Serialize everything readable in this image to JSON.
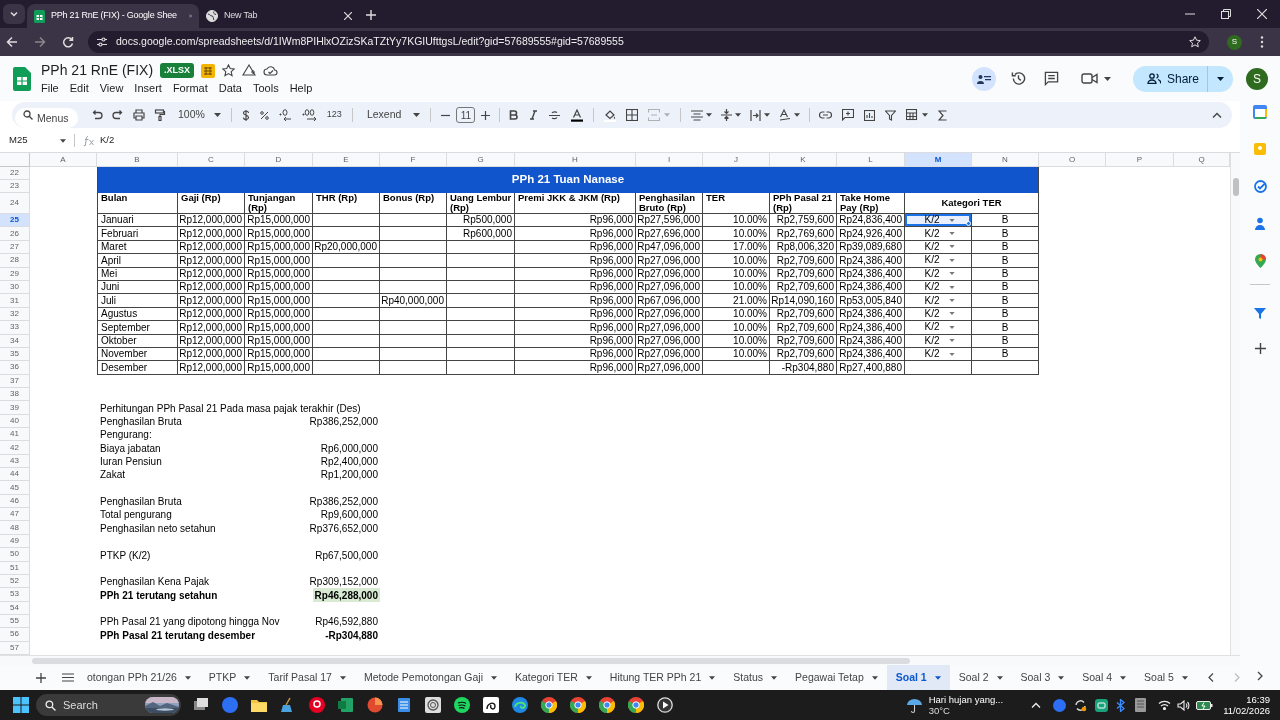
{
  "browser": {
    "tabs": [
      {
        "kind": "sheets",
        "title": "PPh 21 RnE (FIX) - Google Shee",
        "selected": true
      },
      {
        "kind": "web",
        "title": "New Tab",
        "selected": false
      }
    ],
    "url": "docs.google.com/spreadsheets/d/1IWm8PIHlxOZizSKaTZtYy7KGIUfttgsL/edit?gid=57689555#gid=57689555",
    "profile": "S"
  },
  "header": {
    "title": "PPh 21 RnE (FIX)",
    "badge": ".XLSX",
    "menu": [
      "File",
      "Edit",
      "View",
      "Insert",
      "Format",
      "Data",
      "Tools",
      "Help"
    ],
    "share": "Share",
    "avatar": "S"
  },
  "toolbar": {
    "search": {
      "placeholder": "Menus"
    },
    "zoom": "100%",
    "number_format": "123",
    "font": "Lexend",
    "font_size": "11"
  },
  "formula_bar": {
    "cell": "M25",
    "formula": "K/2"
  },
  "sheet": {
    "columns": [
      {
        "label": "A",
        "selected": false
      },
      {
        "label": "B",
        "selected": false
      },
      {
        "label": "C",
        "selected": false
      },
      {
        "label": "D",
        "selected": false
      },
      {
        "label": "E",
        "selected": false
      },
      {
        "label": "F",
        "selected": false
      },
      {
        "label": "G",
        "selected": false
      },
      {
        "label": "H",
        "selected": false
      },
      {
        "label": "I",
        "selected": false
      },
      {
        "label": "J",
        "selected": false
      },
      {
        "label": "K",
        "selected": false
      },
      {
        "label": "L",
        "selected": false
      },
      {
        "label": "M",
        "selected": true
      },
      {
        "label": "N",
        "selected": false
      },
      {
        "label": "O",
        "selected": false
      },
      {
        "label": "P",
        "selected": false
      },
      {
        "label": "Q",
        "selected": false
      }
    ],
    "row_numbers": [
      {
        "label": "22",
        "selected": false
      },
      {
        "label": "23",
        "selected": false
      },
      {
        "label": "24",
        "selected": false
      },
      {
        "label": "25",
        "selected": true
      },
      {
        "label": "26",
        "selected": false
      },
      {
        "label": "27",
        "selected": false
      },
      {
        "label": "28",
        "selected": false
      },
      {
        "label": "29",
        "selected": false
      },
      {
        "label": "30",
        "selected": false
      },
      {
        "label": "31",
        "selected": false
      },
      {
        "label": "32",
        "selected": false
      },
      {
        "label": "33",
        "selected": false
      },
      {
        "label": "34",
        "selected": false
      },
      {
        "label": "35",
        "selected": false
      },
      {
        "label": "36",
        "selected": false
      },
      {
        "label": "37",
        "selected": false
      },
      {
        "label": "38",
        "selected": false
      },
      {
        "label": "39",
        "selected": false
      },
      {
        "label": "40",
        "selected": false
      },
      {
        "label": "41",
        "selected": false
      },
      {
        "label": "42",
        "selected": false
      },
      {
        "label": "43",
        "selected": false
      },
      {
        "label": "44",
        "selected": false
      },
      {
        "label": "45",
        "selected": false
      },
      {
        "label": "46",
        "selected": false
      },
      {
        "label": "47",
        "selected": false
      },
      {
        "label": "48",
        "selected": false
      },
      {
        "label": "49",
        "selected": false
      },
      {
        "label": "50",
        "selected": false
      },
      {
        "label": "51",
        "selected": false
      },
      {
        "label": "52",
        "selected": false
      },
      {
        "label": "53",
        "selected": false
      },
      {
        "label": "54",
        "selected": false
      },
      {
        "label": "55",
        "selected": false
      },
      {
        "label": "56",
        "selected": false
      },
      {
        "label": "57",
        "selected": false
      }
    ],
    "table": {
      "title": "PPh 21 Tuan Nanase",
      "columns": [
        "Bulan",
        "Gaji (Rp)",
        "Tunjangan (Rp)",
        "THR (Rp)",
        "Bonus (Rp)",
        "Uang Lembur (Rp)",
        "Premi JKK & JKM (Rp)",
        "Penghasilan Bruto (Rp)",
        "TER",
        "PPh Pasal 21 (Rp)",
        "Take Home Pay (Rp)",
        "Kategori TER"
      ],
      "rows": [
        {
          "bulan": "Januari",
          "gaji": "Rp12,000,000",
          "tunjangan": "Rp15,000,000",
          "lembur": "Rp500,000",
          "premi": "Rp96,000",
          "bruto": "Rp27,596,000",
          "ter": "10.00%",
          "pph": "Rp2,759,600",
          "thp": "Rp24,836,400",
          "kategori": "K/2",
          "golongan": "B",
          "selected": true
        },
        {
          "bulan": "Februari",
          "gaji": "Rp12,000,000",
          "tunjangan": "Rp15,000,000",
          "lembur": "Rp600,000",
          "premi": "Rp96,000",
          "bruto": "Rp27,696,000",
          "ter": "10.00%",
          "pph": "Rp2,769,600",
          "thp": "Rp24,926,400",
          "kategori": "K/2",
          "golongan": "B",
          "selected": false
        },
        {
          "bulan": "Maret",
          "gaji": "Rp12,000,000",
          "tunjangan": "Rp15,000,000",
          "thr": "Rp20,000,000",
          "premi": "Rp96,000",
          "bruto": "Rp47,096,000",
          "ter": "17.00%",
          "pph": "Rp8,006,320",
          "thp": "Rp39,089,680",
          "kategori": "K/2",
          "golongan": "B",
          "selected": false
        },
        {
          "bulan": "April",
          "gaji": "Rp12,000,000",
          "tunjangan": "Rp15,000,000",
          "premi": "Rp96,000",
          "bruto": "Rp27,096,000",
          "ter": "10.00%",
          "pph": "Rp2,709,600",
          "thp": "Rp24,386,400",
          "kategori": "K/2",
          "golongan": "B",
          "selected": false
        },
        {
          "bulan": "Mei",
          "gaji": "Rp12,000,000",
          "tunjangan": "Rp15,000,000",
          "premi": "Rp96,000",
          "bruto": "Rp27,096,000",
          "ter": "10.00%",
          "pph": "Rp2,709,600",
          "thp": "Rp24,386,400",
          "kategori": "K/2",
          "golongan": "B",
          "selected": false
        },
        {
          "bulan": "Juni",
          "gaji": "Rp12,000,000",
          "tunjangan": "Rp15,000,000",
          "premi": "Rp96,000",
          "bruto": "Rp27,096,000",
          "ter": "10.00%",
          "pph": "Rp2,709,600",
          "thp": "Rp24,386,400",
          "kategori": "K/2",
          "golongan": "B",
          "selected": false
        },
        {
          "bulan": "Juli",
          "gaji": "Rp12,000,000",
          "tunjangan": "Rp15,000,000",
          "bonus": "Rp40,000,000",
          "premi": "Rp96,000",
          "bruto": "Rp67,096,000",
          "ter": "21.00%",
          "pph": "Rp14,090,160",
          "thp": "Rp53,005,840",
          "kategori": "K/2",
          "golongan": "B",
          "selected": false
        },
        {
          "bulan": "Agustus",
          "gaji": "Rp12,000,000",
          "tunjangan": "Rp15,000,000",
          "premi": "Rp96,000",
          "bruto": "Rp27,096,000",
          "ter": "10.00%",
          "pph": "Rp2,709,600",
          "thp": "Rp24,386,400",
          "kategori": "K/2",
          "golongan": "B",
          "selected": false
        },
        {
          "bulan": "September",
          "gaji": "Rp12,000,000",
          "tunjangan": "Rp15,000,000",
          "premi": "Rp96,000",
          "bruto": "Rp27,096,000",
          "ter": "10.00%",
          "pph": "Rp2,709,600",
          "thp": "Rp24,386,400",
          "kategori": "K/2",
          "golongan": "B",
          "selected": false
        },
        {
          "bulan": "Oktober",
          "gaji": "Rp12,000,000",
          "tunjangan": "Rp15,000,000",
          "premi": "Rp96,000",
          "bruto": "Rp27,096,000",
          "ter": "10.00%",
          "pph": "Rp2,709,600",
          "thp": "Rp24,386,400",
          "kategori": "K/2",
          "golongan": "B",
          "selected": false
        },
        {
          "bulan": "November",
          "gaji": "Rp12,000,000",
          "tunjangan": "Rp15,000,000",
          "premi": "Rp96,000",
          "bruto": "Rp27,096,000",
          "ter": "10.00%",
          "pph": "Rp2,709,600",
          "thp": "Rp24,386,400",
          "kategori": "K/2",
          "golongan": "B",
          "selected": false
        },
        {
          "bulan": "Desember",
          "gaji": "Rp12,000,000",
          "tunjangan": "Rp15,000,000",
          "premi": "Rp96,000",
          "bruto": "Rp27,096,000",
          "pph": "-Rp304,880",
          "thp": "Rp27,400,880",
          "selected": false
        }
      ]
    },
    "summary": [
      [
        {
          "label": "Perhitungan PPh Pasal 21 Pada masa pajak terakhir (Des)",
          "bold": false,
          "highlighted": false
        },
        {
          "label": "Penghasilan Bruta",
          "value": "Rp386,252,000",
          "bold": false,
          "highlighted": false
        },
        {
          "label": "Pengurang:",
          "bold": false,
          "highlighted": false
        },
        {
          "label": "Biaya jabatan",
          "value": "Rp6,000,000",
          "bold": false,
          "highlighted": false
        },
        {
          "label": "Iuran Pensiun",
          "value": "Rp2,400,000",
          "bold": false,
          "highlighted": false
        },
        {
          "label": "Zakat",
          "value": "Rp1,200,000",
          "bold": false,
          "highlighted": false
        }
      ],
      [
        {
          "label": "Penghasilan Bruta",
          "value": "Rp386,252,000",
          "bold": false,
          "highlighted": false
        },
        {
          "label": "Total pengurang",
          "value": "Rp9,600,000",
          "bold": false,
          "highlighted": false
        },
        {
          "label": "Penghasilan neto setahun",
          "value": "Rp376,652,000",
          "bold": false,
          "highlighted": false
        }
      ],
      [
        {
          "label": "PTKP (K/2)",
          "value": "Rp67,500,000",
          "bold": false,
          "highlighted": false
        }
      ],
      [
        {
          "label": "Penghasilan Kena Pajak",
          "value": "Rp309,152,000",
          "bold": false,
          "highlighted": false
        },
        {
          "label": "PPh 21 terutang setahun",
          "value": "Rp46,288,000",
          "bold": true,
          "highlighted": true
        }
      ],
      [
        {
          "label": "PPh Pasal 21 yang dipotong hingga Nov",
          "value": "Rp46,592,880",
          "bold": false,
          "highlighted": false
        },
        {
          "label": "PPh Pasal 21 terutang desember",
          "value": "-Rp304,880",
          "bold": true,
          "highlighted": false
        }
      ]
    ]
  },
  "sheet_tabs": [
    {
      "label": "otongan PPh 21/26",
      "selected": false
    },
    {
      "label": "PTKP",
      "selected": false
    },
    {
      "label": "Tarif Pasal 17",
      "selected": false
    },
    {
      "label": "Metode Pemotongan Gaji",
      "selected": false
    },
    {
      "label": "Kategori TER",
      "selected": false
    },
    {
      "label": "Hitung TER PPh 21",
      "selected": false
    },
    {
      "label": "Status",
      "selected": false
    },
    {
      "label": "Pegawai Tetap",
      "selected": false
    },
    {
      "label": "Soal 1",
      "selected": true
    },
    {
      "label": "Soal 2",
      "selected": false
    },
    {
      "label": "Soal 3",
      "selected": false
    },
    {
      "label": "Soal 4",
      "selected": false
    },
    {
      "label": "Soal 5",
      "selected": false
    }
  ],
  "taskbar": {
    "search": "Search",
    "weather": {
      "summary": "Hari hujan yang...",
      "temperature": "30°C"
    },
    "time": "16:39",
    "date": "11/02/2026"
  }
}
